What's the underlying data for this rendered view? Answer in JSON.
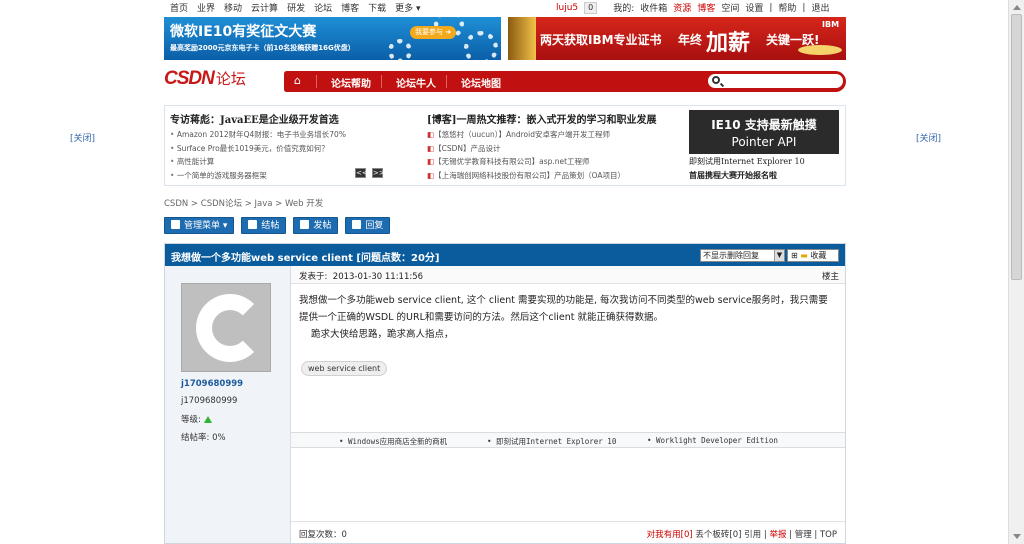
{
  "topnav": {
    "left_items": [
      "首页",
      "业界",
      "移动",
      "云计算",
      "研发",
      "论坛",
      "博客",
      "下载",
      "更多 ▾"
    ],
    "user": "luju5",
    "msg_count": "0",
    "right_items": [
      "我的:",
      "收件箱",
      "资源",
      "博客",
      "空间",
      "设置",
      "|",
      "帮助",
      "|",
      "退出"
    ]
  },
  "banner1": {
    "title": "微软IE10有奖征文大赛",
    "subtitle": "最高奖励2000元京东电子卡（前10名投稿获赠16G优盘）",
    "button": "我要参与 ➜"
  },
  "banner2": {
    "text1": "两天获取IBM专业证书",
    "text2": "年终",
    "text3": "加薪",
    "text4": "关键一跃!",
    "brand": "IBM"
  },
  "logo": {
    "brand": "CSDN",
    "suffix": "论坛"
  },
  "mainnav": {
    "home_icon": "home-icon",
    "items": [
      "论坛帮助",
      "论坛牛人",
      "论坛地图"
    ]
  },
  "close_label": "[关闭]",
  "ads": {
    "col1_title": "专访蒋彪：JavaEE是企业级开发首选",
    "col1_items": [
      "Amazon 2012财年Q4财报：电子书业务增长70%",
      "Surface Pro最长1019美元，价值究竟如何？",
      "高性能计算",
      "一个简单的游戏服务器框架"
    ],
    "col2_title": "[博客]一周热文推荐：嵌入式开发的学习和职业发展",
    "col2_items": [
      "【悠悠村（uucun）】Android安卓客户端开发工程师",
      "【CSDN】产品设计",
      "【无锡优学教育科技有限公司】asp.net工程师",
      "【上海瑞创网络科技股份有限公司】产品策划（OA项目）"
    ],
    "ie_line1": "IE10 支持最新触摸",
    "ie_line2": "Pointer API",
    "ie_caption1": "即刻试用Internet Explorer 10",
    "ie_caption2": "首届携程大赛开始报名啦",
    "pager": [
      "<<",
      ">>"
    ]
  },
  "breadcrumb": "CSDN > CSDN论坛 > Java > Web 开发",
  "toolbar": {
    "manage": "管理菜单 ▾",
    "close": "结帖",
    "post": "发帖",
    "reply": "回复"
  },
  "thread": {
    "title": "我想做一个多功能web service client [问题点数：20分]",
    "filter": "不显示删除回复",
    "fav": "收藏"
  },
  "user": {
    "name_link": "j1709680999",
    "name": "j1709680999",
    "level_label": "等级:",
    "rate_label": "结帖率:",
    "rate": "0%"
  },
  "post": {
    "date_label": "发表于:",
    "date": "2013-01-30 11:11:56",
    "floor": "楼主",
    "line1": "我想做一个多功能web service client, 这个 client 需要实现的功能是, 每次我访问不同类型的web service服务时，我只需要",
    "line2": "提供一个正确的WSDL 的URL和需要访问的方法。然后这个client 就能正确获得数据。",
    "line3": "跪求大侠给思路，跪求高人指点，",
    "tag": "web service client",
    "links": [
      "Windows应用商店全新的商机",
      "即刻试用Internet Explorer 10",
      "Worklight Developer Edition"
    ],
    "reply_count": "回复次数：0",
    "actions_useful": "对我有用[0]",
    "actions_rest": "丢个板砖[0]  引用 | ",
    "report": "举报",
    "actions_end": " | 管理 | TOP"
  }
}
